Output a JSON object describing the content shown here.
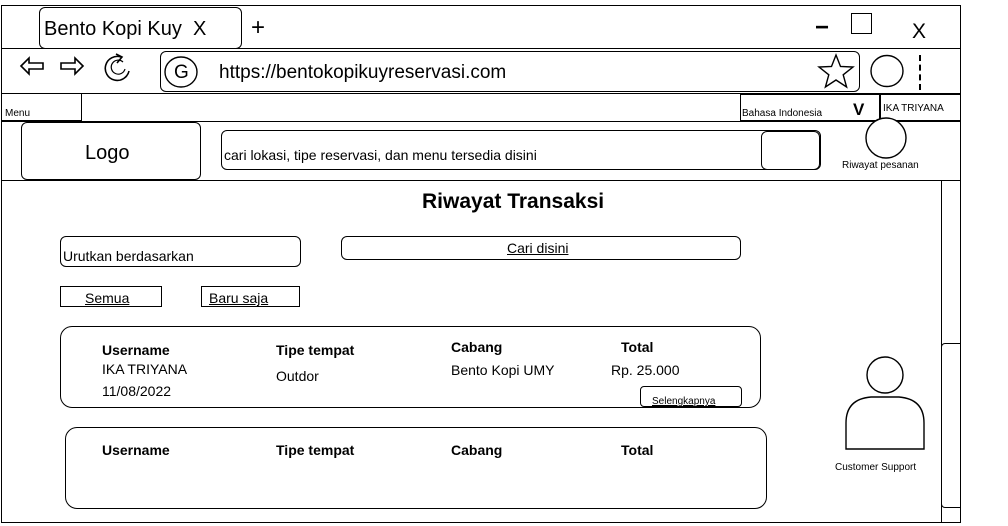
{
  "browser": {
    "tab_title": "Bento Kopi Kuy",
    "tab_close": "X",
    "new_tab": "+",
    "minimize": "−",
    "close": "X",
    "g_icon_letter": "G",
    "url": "https://bentokopikuyreservasi.com"
  },
  "toolbar": {
    "menu": "Menu",
    "language": "Bahasa Indonesia",
    "language_toggle": "V",
    "user": "IKA TRIYANA"
  },
  "header": {
    "logo": "Logo",
    "search_placeholder": "cari lokasi, tipe reservasi, dan menu tersedia disini",
    "history_label": "Riwayat pesanan"
  },
  "main": {
    "title": "Riwayat Transaksi",
    "sort_label": "Urutkan berdasarkan",
    "search_label": "Cari disini",
    "filters": [
      "Semua",
      "Baru saja"
    ],
    "columns": {
      "username": "Username",
      "place_type": "Tipe tempat",
      "branch": "Cabang",
      "total": "Total"
    },
    "transactions": [
      {
        "username": "IKA TRIYANA",
        "date": "11/08/2022",
        "place_type": "Outdor",
        "branch": "Bento Kopi UMY",
        "total": "Rp. 25.000",
        "details_button": "Selengkapnya"
      }
    ]
  },
  "support": {
    "label": "Customer Support"
  }
}
